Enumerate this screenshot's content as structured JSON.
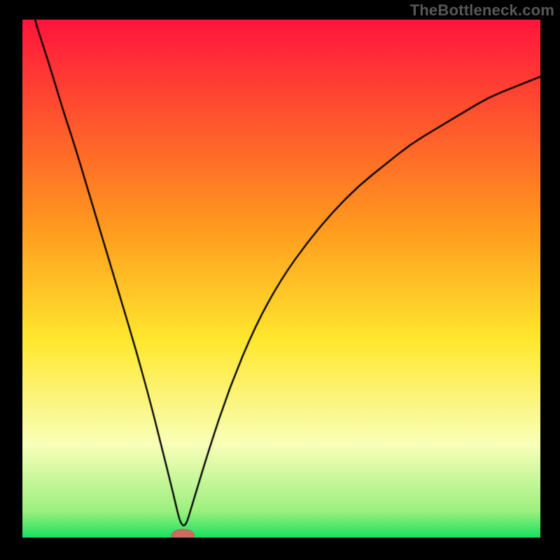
{
  "watermark": "TheBottleneck.com",
  "palette": {
    "frame": "#000000",
    "gradient_top": "#ff153c",
    "gradient_mid1": "#ff8a1e",
    "gradient_mid2": "#ffe82f",
    "gradient_mid3": "#f9ffb9",
    "gradient_bottom": "#18e060",
    "curve": "#000000",
    "marker_fill": "#cf6a62",
    "marker_stroke": "#b85a52"
  },
  "chart_data": {
    "type": "line",
    "title": "",
    "xlabel": "",
    "ylabel": "",
    "xlim": [
      0,
      100
    ],
    "ylim": [
      0,
      100
    ],
    "notes": "V-shaped bottleneck curve over a red→yellow→green vertical gradient. Minimum near x≈31, y≈0. Marker indicates selected configuration at the minimum.",
    "series": [
      {
        "name": "bottleneck-curve",
        "x": [
          0,
          2,
          5,
          8,
          10,
          13,
          16,
          19,
          22,
          25,
          27,
          29,
          31,
          33,
          36,
          40,
          45,
          50,
          55,
          60,
          65,
          70,
          75,
          80,
          85,
          90,
          95,
          100
        ],
        "y": [
          110,
          101,
          92,
          82,
          76,
          66,
          56,
          46,
          36,
          25,
          17,
          9,
          0.5,
          7,
          17,
          29,
          41,
          50,
          57,
          63,
          68,
          72,
          76,
          79,
          82,
          85,
          87,
          89
        ]
      }
    ],
    "marker": {
      "x": 31,
      "y": 0.5,
      "rx": 2.2,
      "ry": 1.1
    },
    "gradient_stops": [
      {
        "t": 0.0,
        "color": "#ff153c"
      },
      {
        "t": 0.4,
        "color": "#ff9a1e"
      },
      {
        "t": 0.62,
        "color": "#ffe82f"
      },
      {
        "t": 0.82,
        "color": "#f9ffb9"
      },
      {
        "t": 0.95,
        "color": "#9bf07f"
      },
      {
        "t": 1.0,
        "color": "#18e060"
      }
    ]
  }
}
